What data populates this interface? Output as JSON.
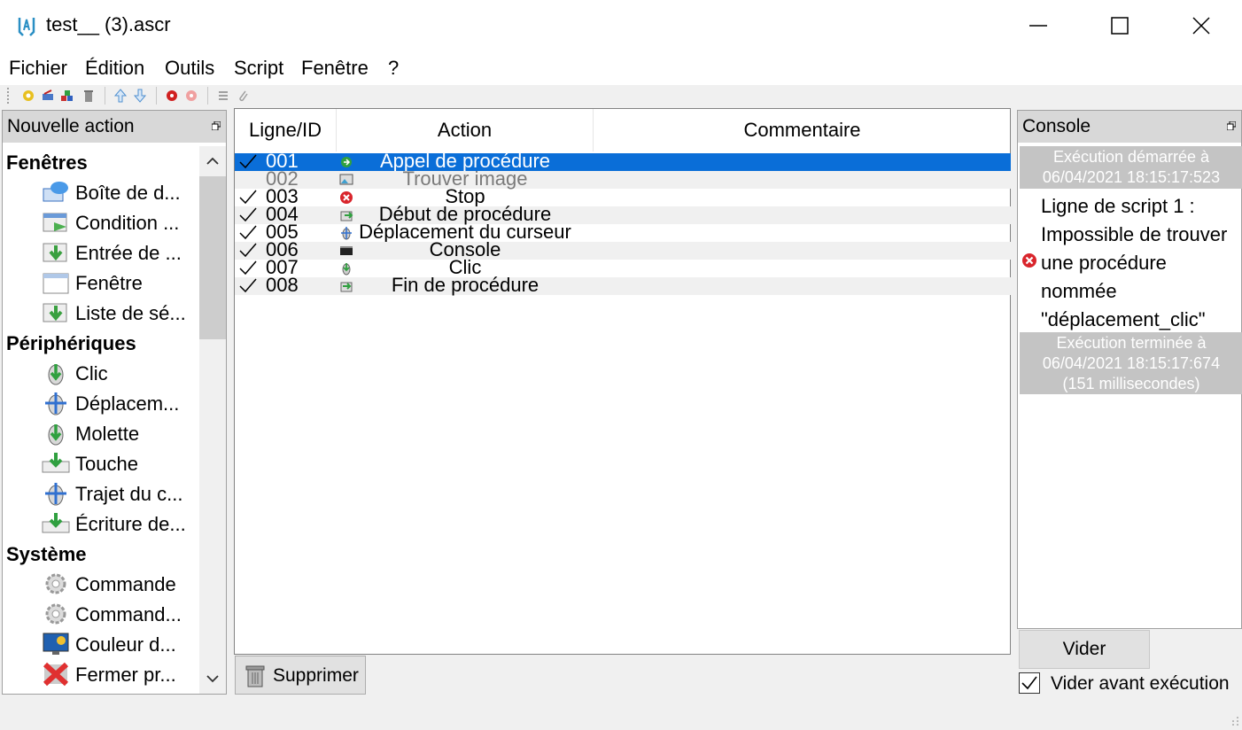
{
  "window": {
    "title": "test__ (3).ascr"
  },
  "menu": [
    "Fichier",
    "Édition",
    "Outils",
    "Script",
    "Fenêtre",
    "?"
  ],
  "left_panel": {
    "title": "Nouvelle action",
    "categories": [
      {
        "label": "Fenêtres",
        "items": [
          "Boîte de d...",
          "Condition ...",
          "Entrée de ...",
          "Fenêtre",
          "Liste de sé..."
        ]
      },
      {
        "label": "Périphériques",
        "items": [
          "Clic",
          "Déplacem...",
          "Molette",
          "Touche",
          "Trajet du c...",
          "Écriture de..."
        ]
      },
      {
        "label": "Système",
        "items": [
          "Commande",
          "Command...",
          "Couleur d...",
          "Fermer pr..."
        ]
      }
    ]
  },
  "grid": {
    "columns": [
      "Ligne/ID",
      "Action",
      "Commentaire"
    ],
    "rows": [
      {
        "id": "001",
        "action": "Appel de procédure",
        "comment": "",
        "icon": "procedure-call-icon"
      },
      {
        "id": "002",
        "action": "Trouver image",
        "comment": "",
        "icon": "find-image-icon"
      },
      {
        "id": "003",
        "action": "Stop",
        "comment": "",
        "icon": "stop-icon"
      },
      {
        "id": "004",
        "action": "Début de procédure",
        "comment": "",
        "icon": "procedure-start-icon"
      },
      {
        "id": "005",
        "action": "Déplacement du curseur",
        "comment": "",
        "icon": "cursor-move-icon"
      },
      {
        "id": "006",
        "action": "Console",
        "comment": "",
        "icon": "console-icon"
      },
      {
        "id": "007",
        "action": "Clic",
        "comment": "",
        "icon": "mouse-click-icon"
      },
      {
        "id": "008",
        "action": "Fin de procédure",
        "comment": "",
        "icon": "procedure-end-icon"
      }
    ],
    "delete_label": "Supprimer"
  },
  "console": {
    "title": "Console",
    "start_msg": [
      "Exécution démarrée à",
      "06/04/2021 18:15:17:523"
    ],
    "error_msg": "Ligne de script 1 : Impossible de trouver une procédure nommée \"déplacement_clic\"",
    "end_msg": [
      "Exécution terminée à",
      "06/04/2021 18:15:17:674",
      "(151 millisecondes)"
    ],
    "clear_label": "Vider",
    "clear_before_label": "Vider avant exécution",
    "clear_before_checked": true
  },
  "colors": {
    "selection": "#0a6ed8",
    "console_box": "#c4c4c4",
    "error": "#d9252c"
  }
}
